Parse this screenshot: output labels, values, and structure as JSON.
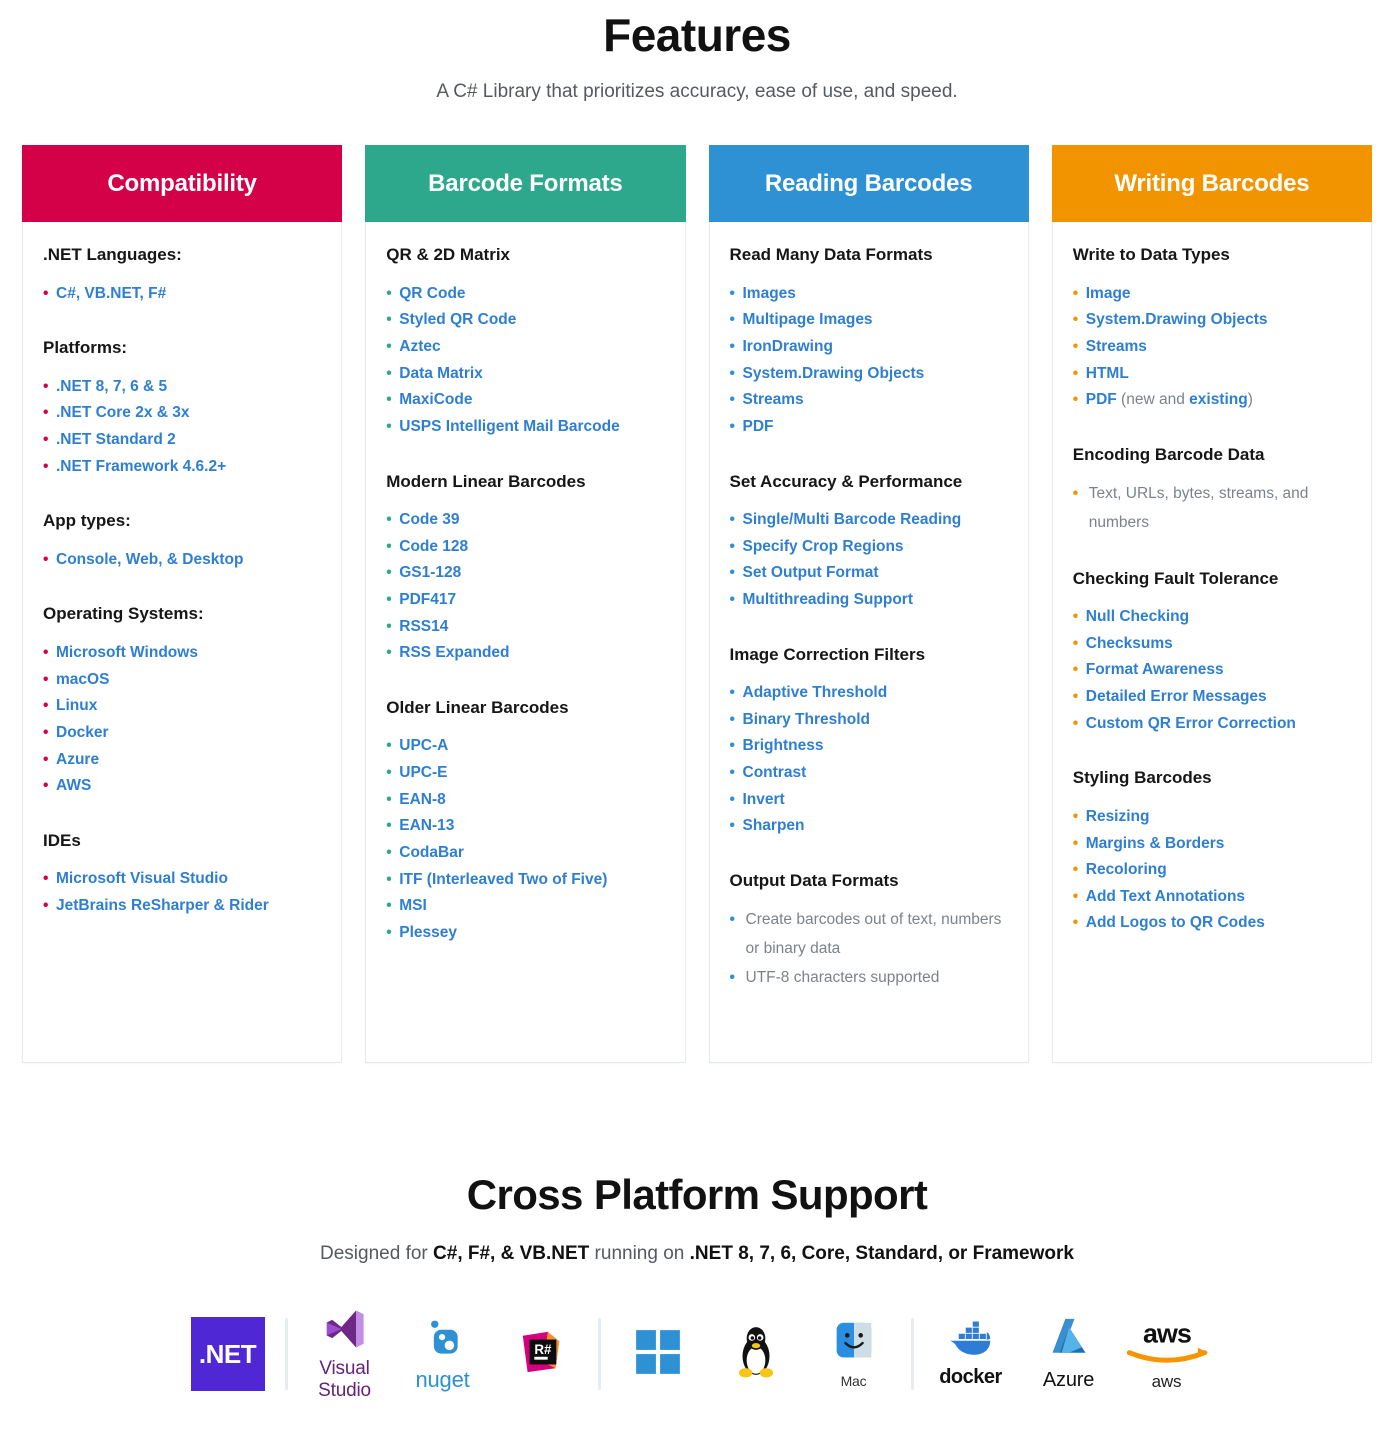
{
  "header": {
    "title": "Features",
    "subtitle": "A C# Library that prioritizes accuracy, ease of use, and speed."
  },
  "colors": {
    "compatibility": "#d40048",
    "barcode_formats": "#2ea88c",
    "reading_barcodes": "#2e91d4",
    "writing_barcodes": "#f29400",
    "link": "#2f7fd1",
    "muted": "#7c8388"
  },
  "cards": [
    {
      "title": "Compatibility",
      "groups": [
        {
          "title": ".NET Languages:",
          "items": [
            "C#, VB.NET, F#"
          ]
        },
        {
          "title": "Platforms:",
          "items": [
            ".NET 8, 7, 6 & 5",
            ".NET Core 2x & 3x",
            ".NET Standard 2",
            ".NET Framework 4.6.2+"
          ]
        },
        {
          "title": "App types:",
          "items": [
            "Console, Web, & Desktop"
          ]
        },
        {
          "title": "Operating Systems:",
          "items": [
            "Microsoft Windows",
            "macOS",
            "Linux",
            "Docker",
            "Azure",
            "AWS"
          ]
        },
        {
          "title": "IDEs",
          "items": [
            "Microsoft Visual Studio",
            "JetBrains ReSharper & Rider"
          ]
        }
      ]
    },
    {
      "title": "Barcode Formats",
      "groups": [
        {
          "title": "QR & 2D Matrix",
          "items": [
            "QR Code",
            "Styled QR Code",
            "Aztec",
            "Data Matrix",
            "MaxiCode",
            "USPS Intelligent Mail Barcode"
          ]
        },
        {
          "title": "Modern Linear Barcodes",
          "items": [
            "Code 39",
            "Code 128",
            "GS1-128",
            "PDF417",
            "RSS14",
            "RSS Expanded"
          ]
        },
        {
          "title": "Older Linear Barcodes",
          "items": [
            "UPC-A",
            "UPC-E",
            "EAN-8",
            "EAN-13",
            "CodaBar",
            "ITF (Interleaved Two of Five)",
            "MSI",
            "Plessey"
          ]
        }
      ]
    },
    {
      "title": "Reading Barcodes",
      "groups": [
        {
          "title": "Read Many Data Formats",
          "items": [
            "Images",
            "Multipage Images",
            "IronDrawing",
            "System.Drawing Objects",
            "Streams",
            "PDF"
          ]
        },
        {
          "title": "Set Accuracy & Performance",
          "items": [
            "Single/Multi Barcode Reading",
            "Specify Crop Regions",
            "Set Output Format",
            "Multithreading Support"
          ]
        },
        {
          "title": "Image Correction Filters",
          "items": [
            "Adaptive Threshold",
            "Binary Threshold",
            "Brightness",
            "Contrast",
            "Invert",
            "Sharpen"
          ]
        },
        {
          "title": "Output Data Formats",
          "plain": true,
          "items": [
            "Create barcodes out of text, numbers or binary data",
            "UTF-8 characters supported"
          ]
        }
      ]
    },
    {
      "title": "Writing Barcodes",
      "groups": [
        {
          "title": "Write to Data Types",
          "items": [
            "Image",
            "System.Drawing Objects",
            "Streams",
            "HTML"
          ],
          "rich_items": [
            {
              "parts": [
                {
                  "t": "PDF",
                  "style": "lnk"
                },
                {
                  "t": " (new and ",
                  "style": "muted"
                },
                {
                  "t": "existing",
                  "style": "lnk"
                },
                {
                  "t": ")",
                  "style": "muted"
                }
              ]
            }
          ]
        },
        {
          "title": "Encoding Barcode Data",
          "plain": true,
          "items": [
            "Text, URLs, bytes, streams, and numbers"
          ]
        },
        {
          "title": "Checking Fault Tolerance",
          "items": [
            "Null Checking",
            "Checksums",
            "Format Awareness",
            "Detailed Error Messages",
            "Custom QR Error Correction"
          ]
        },
        {
          "title": "Styling Barcodes",
          "items": [
            "Resizing",
            "Margins & Borders",
            "Recoloring",
            "Add Text Annotations",
            "Add Logos to QR Codes"
          ]
        }
      ]
    }
  ],
  "cross_platform": {
    "title": "Cross Platform Support",
    "subtitle_parts": [
      {
        "t": "Designed for ",
        "bold": false
      },
      {
        "t": "C#, F#, & VB.NET",
        "bold": true
      },
      {
        "t": " running on ",
        "bold": false
      },
      {
        "t": ".NET 8, 7, 6, Core, Standard, or Framework",
        "bold": true
      }
    ],
    "logos": [
      {
        "name": "dotnet-logo",
        "label": ".NET",
        "caption": ""
      },
      {
        "name": "divider",
        "label": "",
        "caption": ""
      },
      {
        "name": "visual-studio-logo",
        "label": "",
        "caption": "Visual Studio"
      },
      {
        "name": "nuget-logo",
        "label": "",
        "caption": "nuget"
      },
      {
        "name": "resharper-logo",
        "label": "R#",
        "caption": ""
      },
      {
        "name": "divider",
        "label": "",
        "caption": ""
      },
      {
        "name": "windows-logo",
        "label": "",
        "caption": ""
      },
      {
        "name": "linux-logo",
        "label": "",
        "caption": ""
      },
      {
        "name": "mac-logo",
        "label": "",
        "caption": "Mac"
      },
      {
        "name": "divider",
        "label": "",
        "caption": ""
      },
      {
        "name": "docker-logo",
        "label": "",
        "caption": "docker"
      },
      {
        "name": "azure-logo",
        "label": "",
        "caption": "Azure"
      },
      {
        "name": "aws-logo",
        "label": "",
        "caption": "aws"
      }
    ]
  }
}
